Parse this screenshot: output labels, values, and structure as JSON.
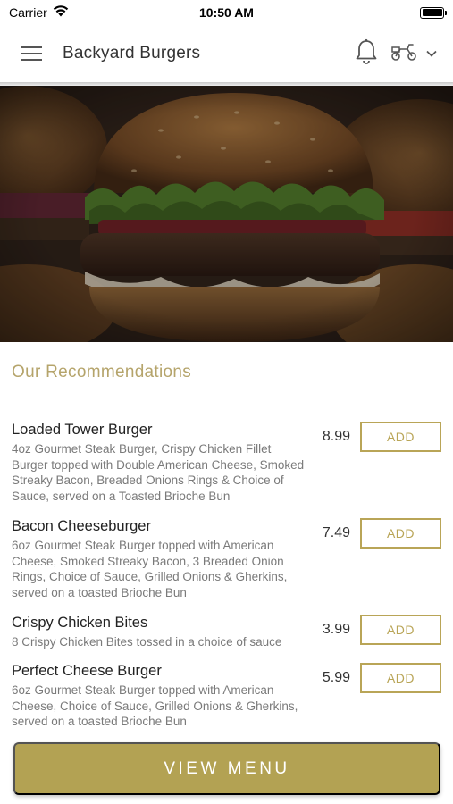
{
  "status_bar": {
    "carrier": "Carrier",
    "time": "10:50 AM"
  },
  "header": {
    "title": "Backyard Burgers",
    "menu_icon": "hamburger-menu-icon",
    "bell_icon": "bell-icon",
    "delivery_icon": "scooter-icon",
    "dropdown_icon": "chevron-down-icon"
  },
  "hero": {
    "image": "burger-photo"
  },
  "recommendations": {
    "title": "Our Recommendations",
    "items": [
      {
        "name": "Loaded Tower Burger",
        "description": "4oz Gourmet Steak Burger, Crispy Chicken Fillet Burger topped with Double American Cheese, Smoked Streaky Bacon, Breaded Onions Rings & Choice of Sauce, served on a Toasted Brioche Bun",
        "price": "8.99",
        "add_label": "ADD"
      },
      {
        "name": "Bacon Cheeseburger",
        "description": "6oz Gourmet Steak Burger topped with American Cheese, Smoked Streaky Bacon, 3 Breaded Onion Rings, Choice of Sauce, Grilled Onions & Gherkins, served on a toasted Brioche Bun",
        "price": "7.49",
        "add_label": "ADD"
      },
      {
        "name": "Crispy Chicken Bites",
        "description": "8 Crispy Chicken Bites tossed in a choice of sauce",
        "price": "3.99",
        "add_label": "ADD"
      },
      {
        "name": "Perfect Cheese Burger",
        "description": "6oz Gourmet Steak Burger topped with American Cheese, Choice of Sauce, Grilled Onions & Gherkins, served on a toasted Brioche Bun",
        "price": "5.99",
        "add_label": "ADD"
      }
    ]
  },
  "footer": {
    "view_menu_label": "VIEW MENU"
  },
  "colors": {
    "accent": "#b9a557",
    "button_fill": "#b3a253",
    "section_title": "#b5a46b",
    "description_text": "#7a7a7a"
  }
}
